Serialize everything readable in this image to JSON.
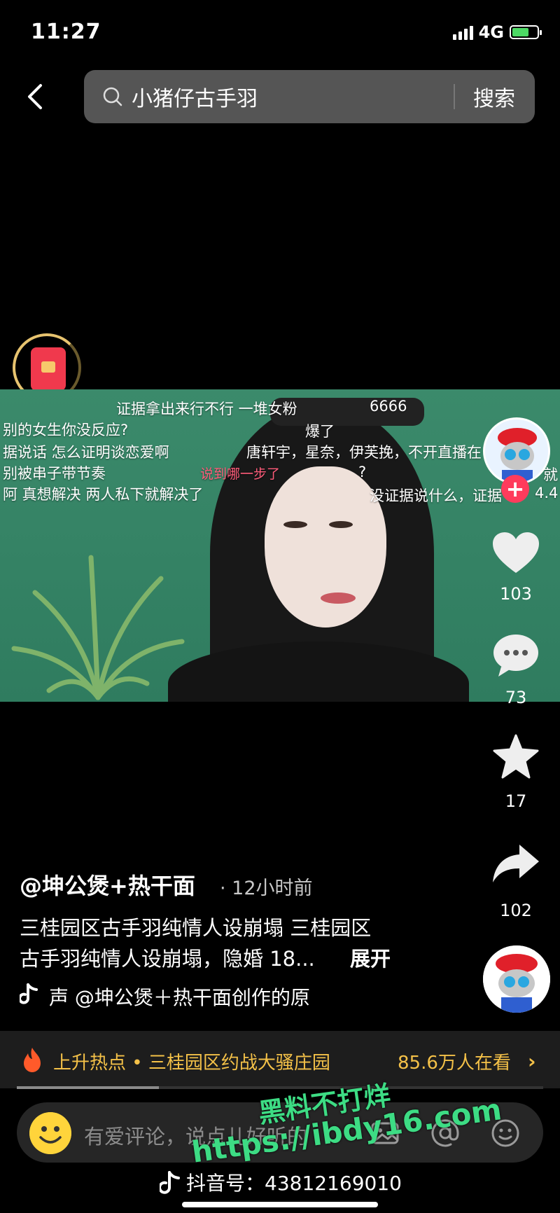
{
  "status_bar": {
    "time": "11:27",
    "network": "4G"
  },
  "search": {
    "query": "小猪仔古手羽",
    "button": "搜索"
  },
  "video": {
    "danmu": [
      "证据拿出来行不行  一堆女粉",
      "6666",
      "别的女生你没反应?",
      "爆了",
      "据说话  怎么证明谈恋爱啊",
      "唐轩宇，星奈，伊芙挽，不开直播在",
      "别被串子带节奏",
      "说到哪一步了",
      "?",
      "就",
      "阿  真想解决  两人私下就解决了",
      "没证据说什么，证据",
      "4.4",
      "?"
    ]
  },
  "sidebar": {
    "likes": "103",
    "comments": "73",
    "favorites": "17",
    "shares": "102"
  },
  "caption": {
    "author": "@坤公煲+热干面",
    "time_ago": "· 12小时前",
    "line1": "三桂园区古手羽纯情人设崩塌 三桂园区",
    "line2": "古手羽纯情人设崩塌，隐婚 18...",
    "expand": "展开",
    "music": "声    @坤公煲＋热干面创作的原"
  },
  "hot": {
    "topic": "上升热点 • 三桂园区约战大骚庄园",
    "viewers": "85.6万人在看",
    "progress": 0.27
  },
  "comment": {
    "placeholder": "有爱评论，说点儿好听的"
  },
  "footer": {
    "douyin_id": "抖音号：43812169010"
  },
  "watermark": {
    "line1": "黑料不打烊",
    "line2": "https://ibdy16.com"
  },
  "colors": {
    "hot_accent": "#f4c148",
    "like_red": "#ff3b5c",
    "watermark_green": "#3ddc84"
  }
}
